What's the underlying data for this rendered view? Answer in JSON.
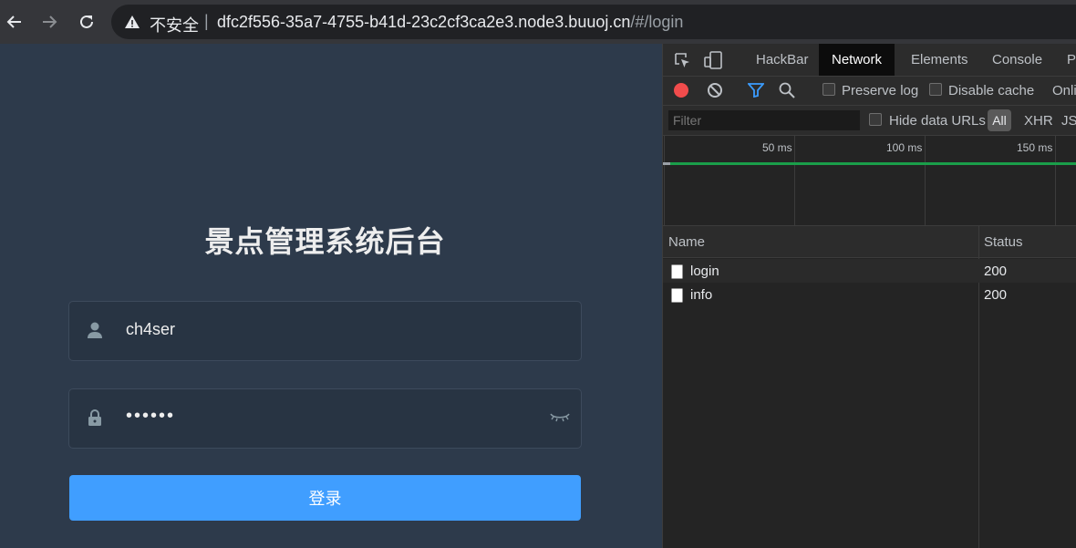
{
  "browser": {
    "insecure_label": "不安全",
    "separator": "|",
    "url_host": "dfc2f556-35a7-4755-b41d-23c2cf3ca2e3.node3.buuoj.cn",
    "url_path": "/#/login"
  },
  "login": {
    "title": "景点管理系统后台",
    "username_value": "ch4ser",
    "password_mask": "••••••",
    "submit_label": "登录"
  },
  "devtools": {
    "tabs": [
      "HackBar",
      "Network",
      "Elements",
      "Console",
      "Pe"
    ],
    "active_tab": "Network",
    "preserve_log_label": "Preserve log",
    "disable_cache_label": "Disable cache",
    "online_label": "Onli",
    "filter_placeholder": "Filter",
    "hide_data_urls_label": "Hide data URLs",
    "type_filters": [
      "All",
      "XHR",
      "JS"
    ],
    "timeline_ticks": [
      "50 ms",
      "100 ms",
      "150 ms"
    ],
    "columns": [
      "Name",
      "Status"
    ],
    "requests": [
      {
        "name": "login",
        "status": "200"
      },
      {
        "name": "info",
        "status": "200"
      }
    ]
  },
  "colors": {
    "page_bg": "#2d3a4b",
    "button_blue": "#409eff",
    "record_red": "#f14c4c"
  }
}
